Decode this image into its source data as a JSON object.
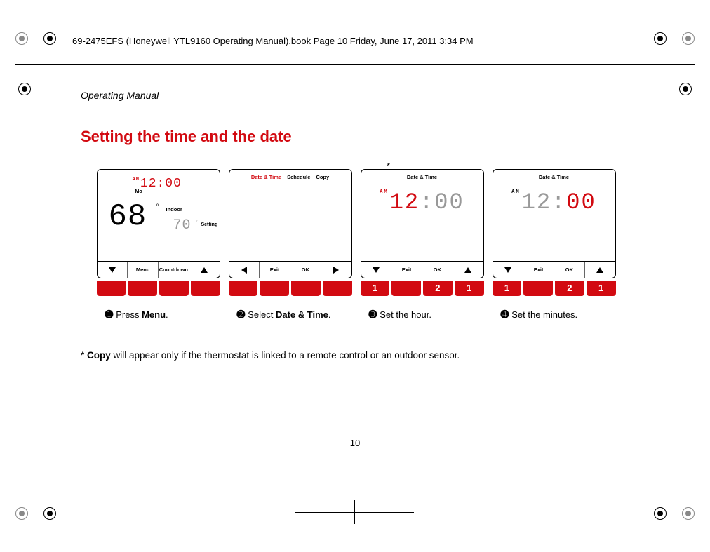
{
  "header": "69-2475EFS (Honeywell YTL9160 Operating Manual).book  Page 10  Friday, June 17, 2011  3:34 PM",
  "doc_label": "Operating Manual",
  "section_title": "Setting the time and the date",
  "asterisk": "*",
  "screen1": {
    "am": "AM",
    "time": "12:00",
    "day": "Mo",
    "temp_main": "68",
    "deg": "°",
    "indoor": "Indoor",
    "temp_set": "70",
    "setting": "Setting",
    "btns": {
      "b1": "",
      "b2": "Menu",
      "b3": "Countdown",
      "b4": ""
    }
  },
  "screen2": {
    "tabs": {
      "t1": "Date & Time",
      "t2": "Schedule",
      "t3": "Copy"
    },
    "btns": {
      "b1": "",
      "b2": "Exit",
      "b3": "OK",
      "b4": ""
    }
  },
  "screen3": {
    "tab": "Date & Time",
    "am": "AM",
    "hour": "12",
    "colon": ":",
    "min": "00",
    "btns": {
      "b1": "",
      "b2": "Exit",
      "b3": "OK",
      "b4": ""
    },
    "red": {
      "r1": "1",
      "r2": "2",
      "r3": "1"
    }
  },
  "screen4": {
    "tab": "Date & Time",
    "am": "AM",
    "hour": "12",
    "colon": ":",
    "min": "00",
    "btns": {
      "b1": "",
      "b2": "Exit",
      "b3": "OK",
      "b4": ""
    },
    "red": {
      "r1": "1",
      "r2": "2",
      "r3": "1"
    }
  },
  "captions": {
    "c1": {
      "num": "➊",
      "pre": "Press ",
      "bold": "Menu",
      "post": "."
    },
    "c2": {
      "num": "➋",
      "pre": "Select ",
      "bold": "Date & Time",
      "post": "."
    },
    "c3": {
      "num": "➌",
      "text": "Set the hour."
    },
    "c4": {
      "num": "➍",
      "text": "Set the minutes."
    }
  },
  "footnote": {
    "pre": "* ",
    "bold": "Copy",
    "post": " will appear only if the thermostat is linked to a remote control or an outdoor sensor."
  },
  "page_number": "10"
}
